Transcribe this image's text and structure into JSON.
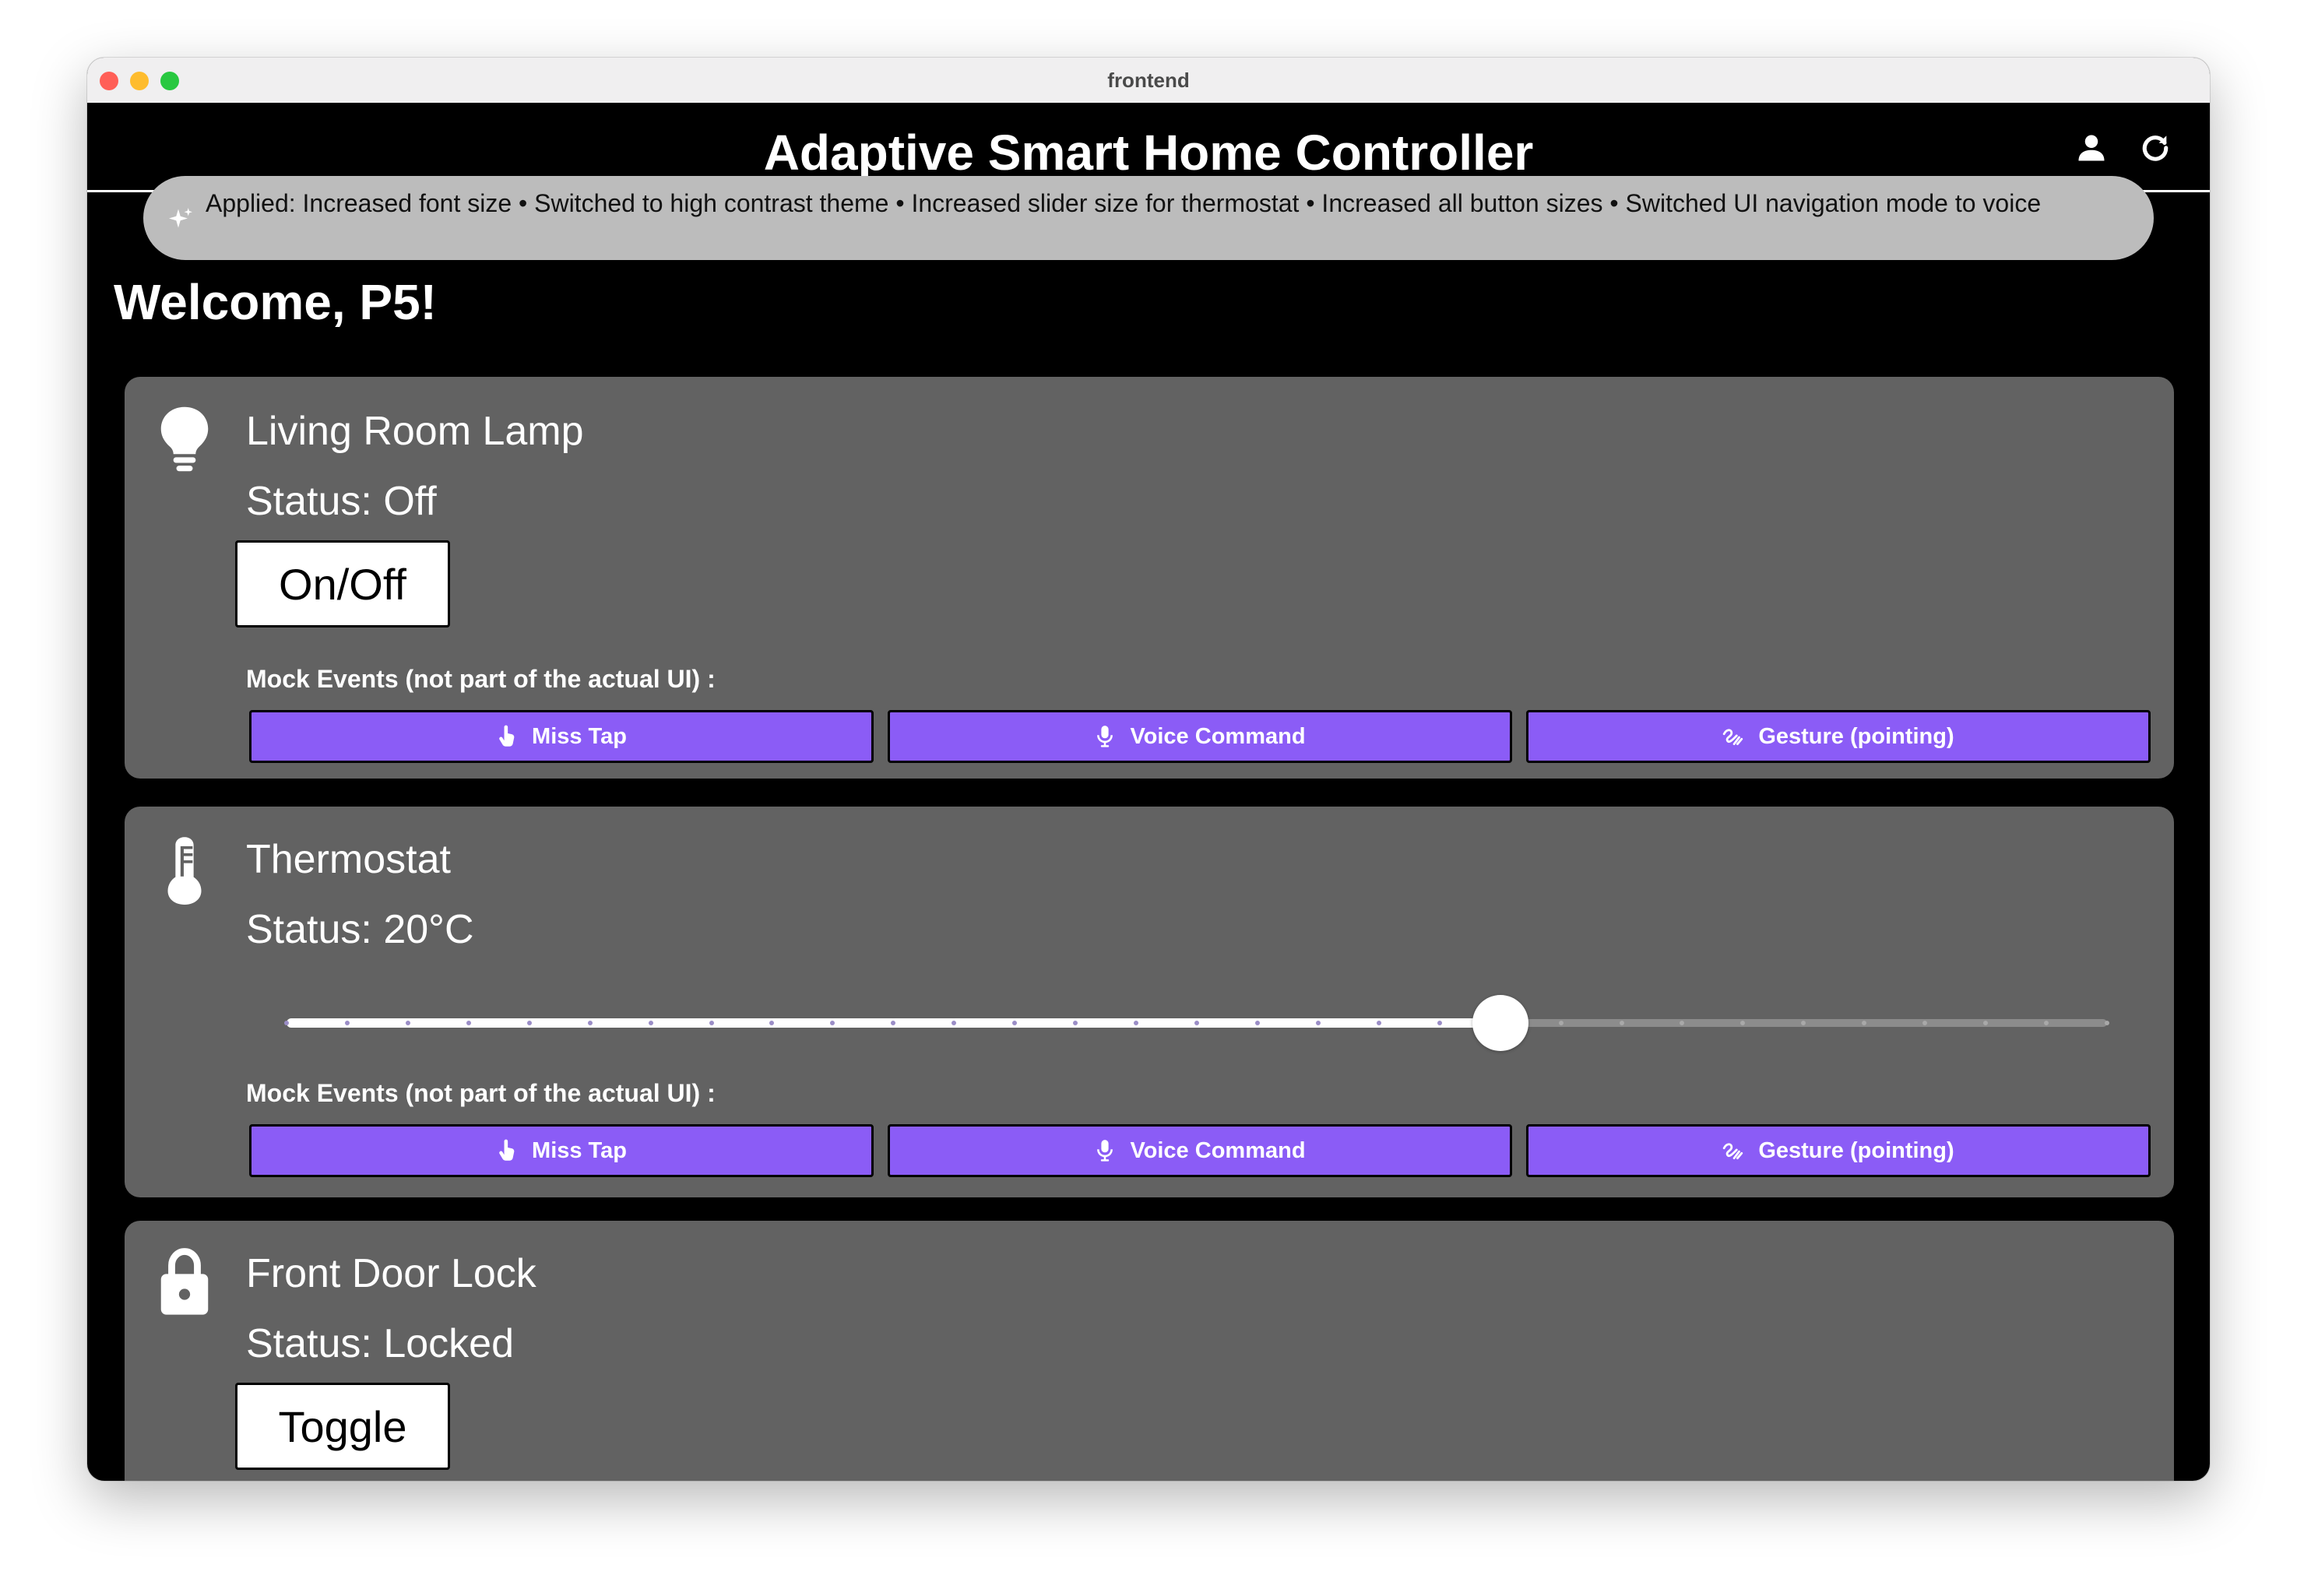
{
  "window": {
    "title": "frontend"
  },
  "app": {
    "title": "Adaptive Smart Home Controller"
  },
  "banner": {
    "text": "Applied: Increased font size • Switched to high contrast theme • Increased slider size for thermostat • Increased all button sizes • Switched UI navigation mode to voice"
  },
  "welcome": "Welcome, P5!",
  "devices": {
    "lamp": {
      "name": "Living Room Lamp",
      "status": "Status: Off",
      "action_label": "On/Off",
      "icon": "lightbulb-icon"
    },
    "thermostat": {
      "name": "Thermostat",
      "status": "Status: 20°C",
      "icon": "thermometer-icon",
      "slider": {
        "min": 0,
        "max": 30,
        "value": 20,
        "divisions": 30
      }
    },
    "lock": {
      "name": "Front Door Lock",
      "status": "Status: Locked",
      "action_label": "Toggle",
      "icon": "lock-icon"
    }
  },
  "mock_events": {
    "label": "Mock Events (not part of the actual UI) :",
    "miss_tap": "Miss Tap",
    "voice_command": "Voice Command",
    "gesture": "Gesture (pointing)"
  },
  "colors": {
    "background": "#000000",
    "card": "#626262",
    "banner": "#bcbcbc",
    "accent": "#8b5cf6",
    "tick_on_fill": "#9b8ec7",
    "tick_on_track": "#a8a8a8"
  }
}
